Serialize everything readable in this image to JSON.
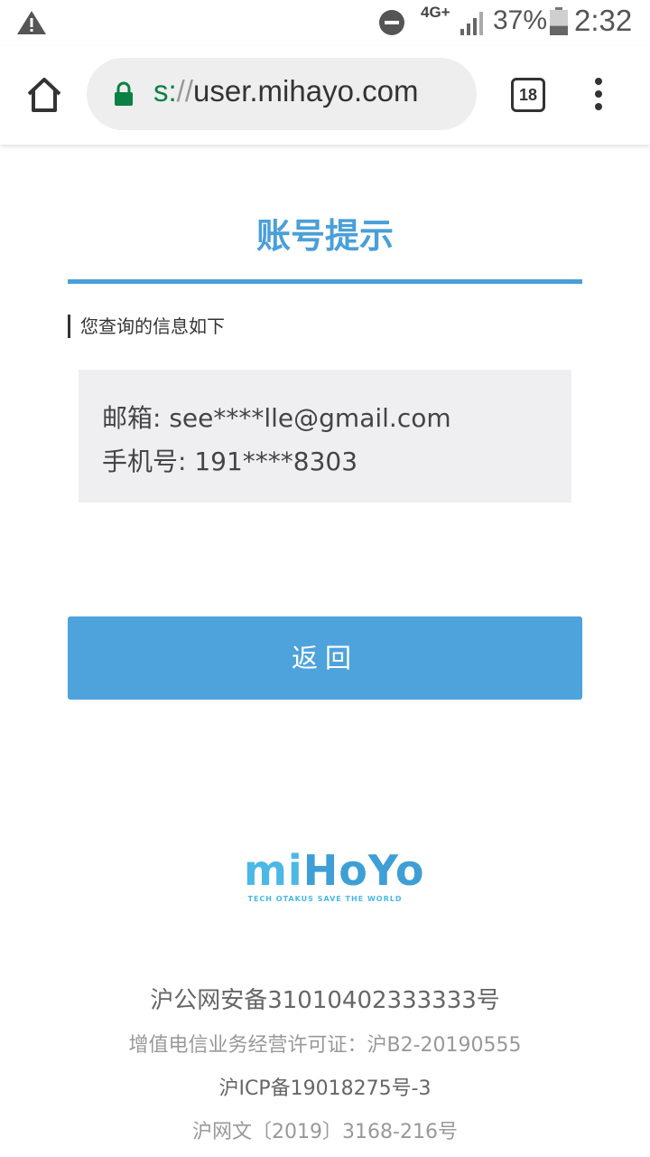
{
  "status_bar": {
    "network": "4G+",
    "battery_percent": "37%",
    "battery_level": 0.37,
    "time": "2:32"
  },
  "browser": {
    "url_scheme": "s:",
    "url_sep": "//",
    "url_host": "user.mihayo.com",
    "tab_count": "18"
  },
  "page": {
    "title": "账号提示",
    "section_label": "您查询的信息如下",
    "email_line": "邮箱: see****lle@gmail.com",
    "phone_line": "手机号: 191****8303",
    "back_button": "返回"
  },
  "logo": {
    "wordmark": "miHoYo",
    "slogan": "TECH OTAKUS SAVE THE WORLD"
  },
  "footer": {
    "line1": "沪公网安备31010402333333号",
    "line2": "增值电信业务经营许可证：沪B2-20190555",
    "line3": "沪ICP备19018275号-3",
    "line4": "沪网文〔2019〕3168-216号"
  },
  "colors": {
    "accent": "#4a9fd8",
    "button": "#4ea3dc",
    "info_bg": "#efeff2",
    "secure_green": "#0b8043"
  }
}
